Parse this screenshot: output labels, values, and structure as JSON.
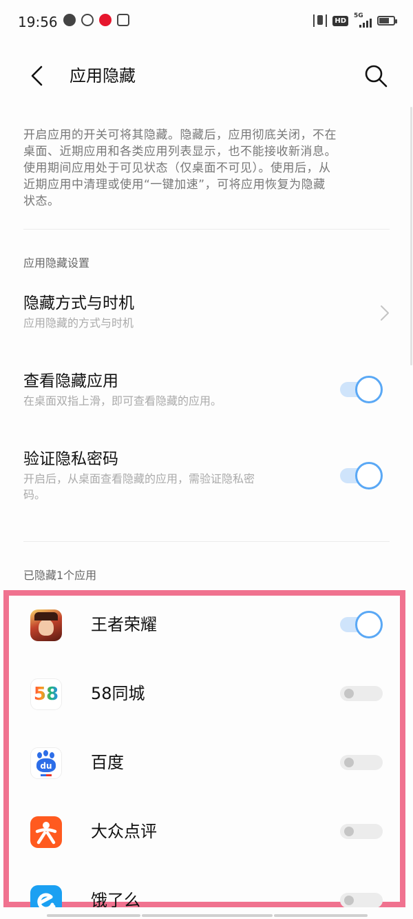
{
  "status_bar": {
    "time": "19:56",
    "left_icons": [
      "music-icon",
      "hotspot-icon",
      "weibo-icon",
      "play-icon"
    ],
    "hd_label": "HD",
    "network_label": "5G"
  },
  "header": {
    "title": "应用隐藏"
  },
  "description_lines": [
    "开启应用的开关可将其隐藏。隐藏后，应用彻底关闭，不在",
    "桌面、近期应用和各类应用列表显示，也不能接收新消息。",
    "使用期间应用处于可见状态（仅桌面不可见）。使用后，从",
    "近期应用中清理或使用“一键加速”，可将应用恢复为隐藏",
    "状态。"
  ],
  "settings_section": {
    "header": "应用隐藏设置",
    "items": [
      {
        "title": "隐藏方式与时机",
        "subtitle": "应用隐藏的方式与时机",
        "control": "chevron"
      },
      {
        "title": "查看隐藏应用",
        "subtitle": "在桌面双指上滑，即可查看隐藏的应用。",
        "control": "toggle",
        "on": true
      },
      {
        "title": "验证隐私密码",
        "subtitle_lines": [
          "开启后，从桌面查看隐藏的应用，需验证隐私密",
          "码。"
        ],
        "control": "toggle",
        "on": true
      }
    ]
  },
  "hidden_section": {
    "header": "已隐藏1个应用"
  },
  "apps": [
    {
      "name": "王者荣耀",
      "on": true,
      "icon": "honor-of-kings-icon"
    },
    {
      "name": "58同城",
      "on": false,
      "icon": "58-city-icon",
      "icon_text": "58"
    },
    {
      "name": "百度",
      "on": false,
      "icon": "baidu-icon",
      "icon_text": "du"
    },
    {
      "name": "大众点评",
      "on": false,
      "icon": "dianping-icon"
    },
    {
      "name": "饿了么",
      "on": false,
      "icon": "eleme-icon"
    }
  ],
  "colors": {
    "accent": "#5aa8f5",
    "highlight_border": "#f0728f"
  }
}
